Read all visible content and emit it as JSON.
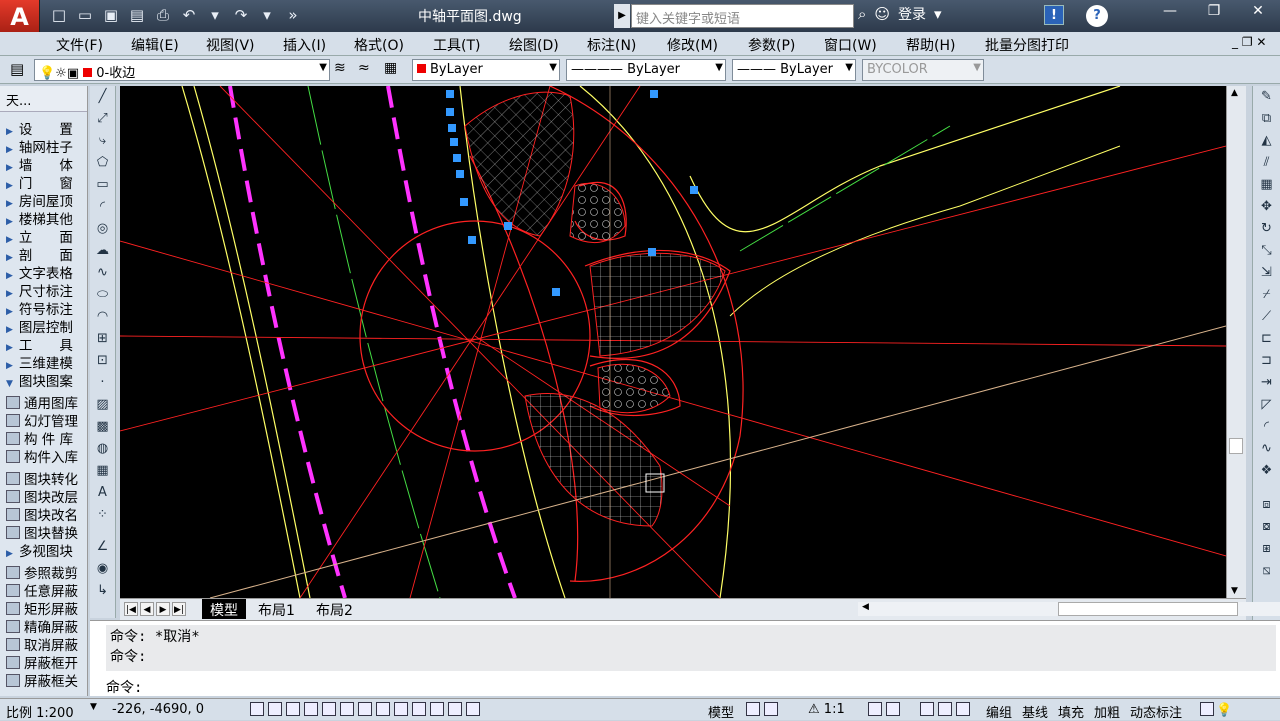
{
  "app": {
    "logo": "A",
    "doc_title": "中轴平面图.dwg",
    "search_placeholder": "键入关键字或短语",
    "login": "登录"
  },
  "menu": [
    "文件(F)",
    "编辑(E)",
    "视图(V)",
    "插入(I)",
    "格式(O)",
    "工具(T)",
    "绘图(D)",
    "标注(N)",
    "修改(M)",
    "参数(P)",
    "窗口(W)",
    "帮助(H)",
    "批量分图打印"
  ],
  "toolbar": {
    "layer": "0-收边",
    "color": "ByLayer",
    "linetype": "ByLayer",
    "lineweight": "ByLayer",
    "plotstyle": "BYCOLOR"
  },
  "panel": {
    "title": "天...",
    "items": [
      "设　　置",
      "轴网柱子",
      "墙　　体",
      "门　　窗",
      "房间屋顶",
      "楼梯其他",
      "立　　面",
      "剖　　面",
      "文字表格",
      "尺寸标注",
      "符号标注",
      "图层控制",
      "工　　具",
      "三维建模",
      "图块图案"
    ],
    "tools": [
      "通用图库",
      "幻灯管理",
      "构 件 库",
      "构件入库"
    ],
    "tools2": [
      "图块转化",
      "图块改层",
      "图块改名",
      "图块替换",
      "多视图块"
    ],
    "tools3": [
      "参照裁剪",
      "任意屏蔽",
      "矩形屏蔽",
      "精确屏蔽",
      "取消屏蔽",
      "屏蔽框开",
      "屏蔽框关"
    ]
  },
  "tabs": [
    "模型",
    "布局1",
    "布局2"
  ],
  "command": {
    "history": [
      "命令: *取消*",
      "命令:"
    ],
    "prompt": "命令:"
  },
  "status": {
    "scale": "比例 1:200",
    "coords": "-226, -4690, 0",
    "model": "模型",
    "annoscale": "1:1",
    "right": [
      "编组",
      "基线",
      "填充",
      "加粗",
      "动态标注"
    ]
  }
}
